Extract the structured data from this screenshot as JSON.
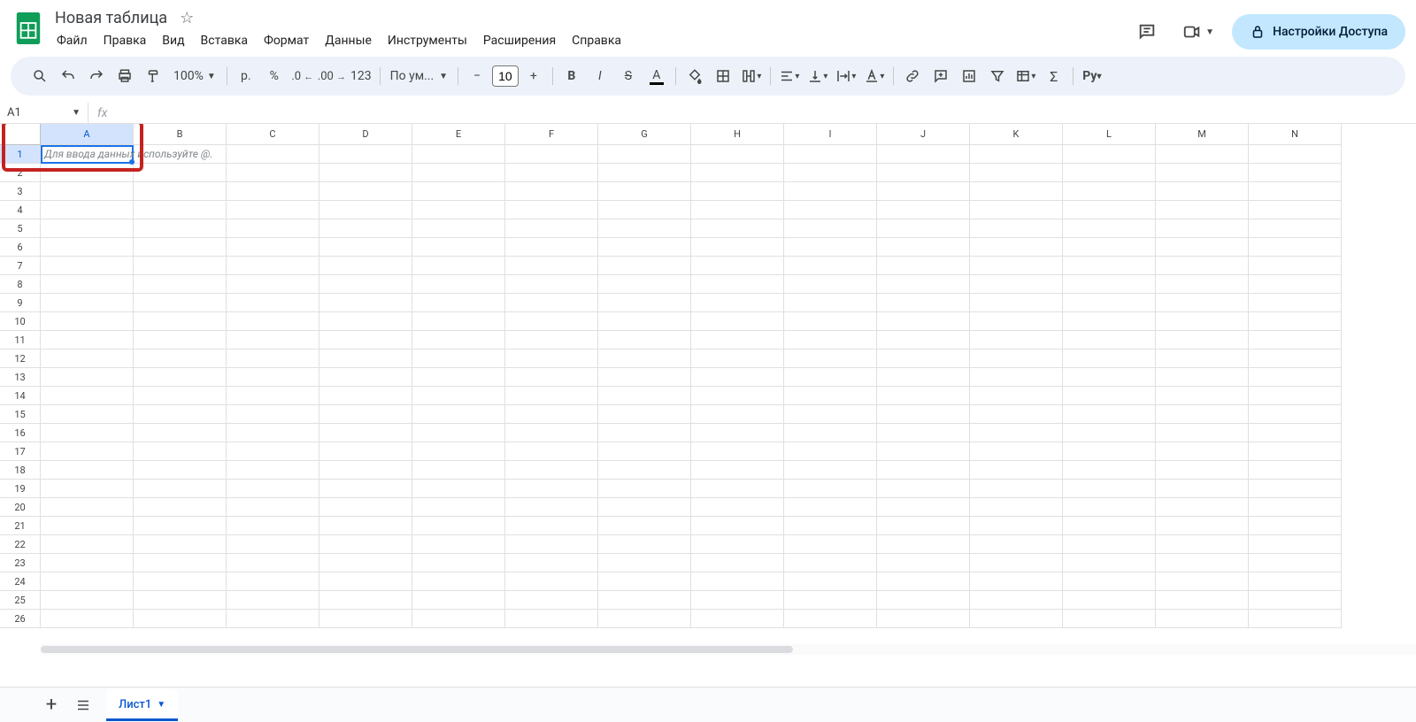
{
  "header": {
    "doc_title": "Новая таблица",
    "share_label": "Настройки Доступа"
  },
  "menubar": {
    "items": [
      "Файл",
      "Правка",
      "Вид",
      "Вставка",
      "Формат",
      "Данные",
      "Инструменты",
      "Расширения",
      "Справка"
    ]
  },
  "toolbar": {
    "zoom": "100%",
    "currency": "р.",
    "percent": "%",
    "number_format": "123",
    "font": "По ум...",
    "font_size": "10"
  },
  "formula_bar": {
    "name_box": "A1",
    "fx": "fx"
  },
  "grid": {
    "columns": [
      "A",
      "B",
      "C",
      "D",
      "E",
      "F",
      "G",
      "H",
      "I",
      "J",
      "K",
      "L",
      "M",
      "N"
    ],
    "row_count": 26,
    "active_cell": "A1",
    "placeholder": "Для ввода данных используйте @."
  },
  "sheets": {
    "active": "Лист1"
  }
}
